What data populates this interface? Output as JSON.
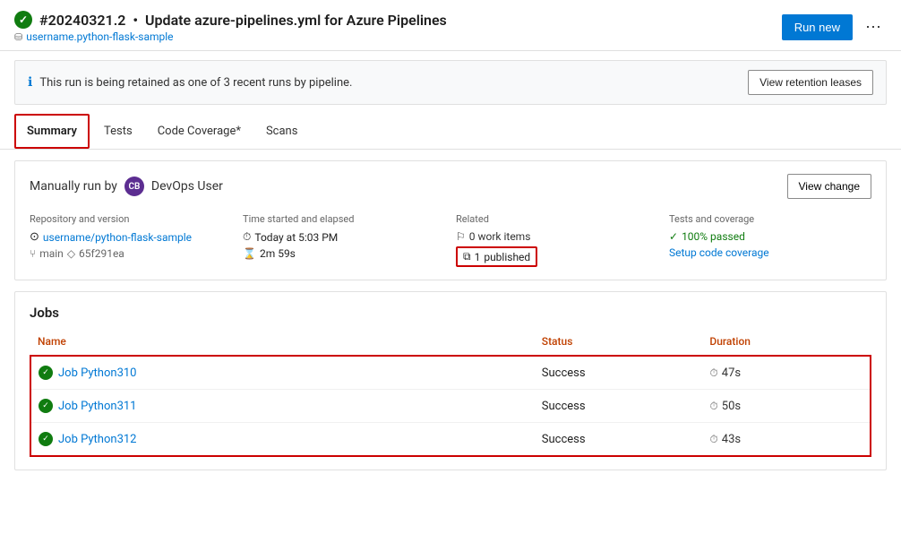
{
  "header": {
    "run_number": "#20240321.2",
    "separator": "•",
    "title": "Update azure-pipelines.yml for Azure Pipelines",
    "subtitle": "username.python-flask-sample",
    "run_new_label": "Run new",
    "more_icon": "⋯"
  },
  "retention": {
    "message": "This run is being retained as one of 3 recent runs by pipeline.",
    "view_leases_label": "View retention leases"
  },
  "tabs": [
    {
      "id": "summary",
      "label": "Summary",
      "active": true
    },
    {
      "id": "tests",
      "label": "Tests",
      "active": false
    },
    {
      "id": "coverage",
      "label": "Code Coverage*",
      "active": false
    },
    {
      "id": "scans",
      "label": "Scans",
      "active": false
    }
  ],
  "summary_card": {
    "manually_run_prefix": "Manually run by",
    "user_initials": "CB",
    "user_name": "DevOps User",
    "view_change_label": "View change",
    "meta": {
      "repository": {
        "label": "Repository and version",
        "repo_name": "username/python-flask-sample",
        "branch": "main",
        "commit": "65f291ea"
      },
      "time": {
        "label": "Time started and elapsed",
        "started": "Today at 5:03 PM",
        "elapsed": "2m 59s"
      },
      "related": {
        "label": "Related",
        "work_items": "0 work items",
        "published_count": "1",
        "published_label": "published"
      },
      "tests": {
        "label": "Tests and coverage",
        "passed": "100% passed",
        "setup_link": "Setup code coverage"
      }
    }
  },
  "jobs": {
    "title": "Jobs",
    "columns": {
      "name": "Name",
      "status": "Status",
      "duration": "Duration"
    },
    "rows": [
      {
        "name": "Job Python310",
        "status": "Success",
        "duration": "47s"
      },
      {
        "name": "Job Python311",
        "status": "Success",
        "duration": "50s"
      },
      {
        "name": "Job Python312",
        "status": "Success",
        "duration": "43s"
      }
    ]
  },
  "colors": {
    "accent": "#0078d4",
    "success": "#107c10",
    "red_border": "#c00",
    "text_primary": "#1e1e1e",
    "text_secondary": "#666"
  }
}
